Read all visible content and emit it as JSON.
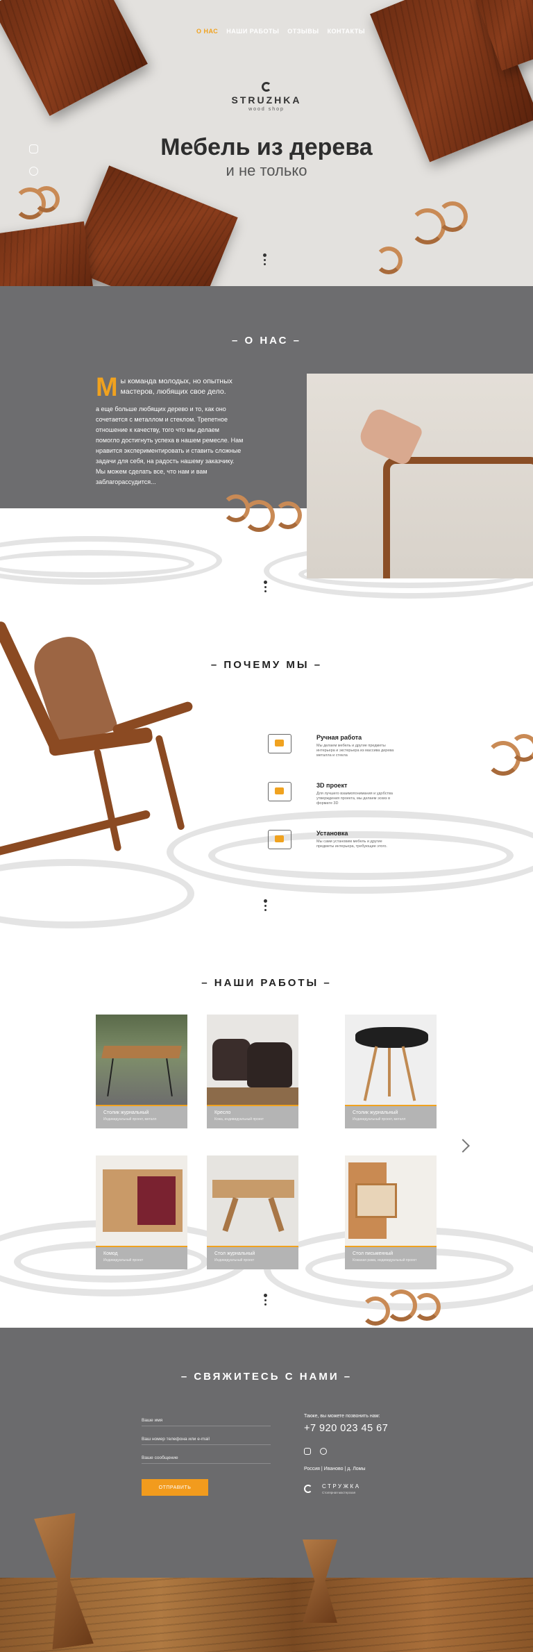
{
  "nav": {
    "items": [
      "О НАС",
      "НАШИ РАБОТЫ",
      "ОТЗЫВЫ",
      "КОНТАКТЫ"
    ]
  },
  "hero": {
    "logo_name": "STRUZHKA",
    "logo_sub": "wood shop",
    "title": "Мебель из дерева",
    "subtitle": "и не только"
  },
  "about": {
    "title": "– О НАС –",
    "dropcap": "М",
    "lead": "ы команда молодых, но опытных мастеров, любящих свое дело.",
    "body": "а еще больше любящих дерево и то, как оно сочетается с металлом и стеклом. Трепетное отношение к качеству, того что мы делаем помогло достигнуть успеха в нашем ремесле. Нам нравится экспериментировать и ставить сложные задачи для себя, на радость нашему заказчику. Мы можем сделать все, что нам и вам заблагорассудится..."
  },
  "why": {
    "title": "– ПОЧЕМУ МЫ –",
    "features": [
      {
        "title": "Ручная работа",
        "desc": "Мы делаем мебель и другие предметы интерьера и экстерьера из массива дерева металла и стекла"
      },
      {
        "title": "3D проект",
        "desc": "Для лучшего взаимопонимания и удобства утверждения проекта, мы делаем эскиз в формате 3D"
      },
      {
        "title": "Установка",
        "desc": "Мы сами установим мебель и другие предметы интерьера, требующие этого."
      }
    ]
  },
  "works": {
    "title": "– НАШИ РАБОТЫ –",
    "cards": [
      {
        "name": "Столик журнальный",
        "desc": "Индивидуальный проект, металл"
      },
      {
        "name": "Кресло",
        "desc": "Кожа, индивидуальный проект"
      },
      {
        "name": "Столик журнальный",
        "desc": "Индивидуальный проект, металл"
      },
      {
        "name": "Комод",
        "desc": "Индивидуальный проект"
      },
      {
        "name": "Стол журнальный",
        "desc": "Индивидуальный проект"
      },
      {
        "name": "Стол письменный",
        "desc": "Кожаная рама, индивидуальный проект"
      }
    ]
  },
  "contact": {
    "title": "– СВЯЖИТЕСЬ С НАМИ –",
    "placeholders": {
      "name": "Ваше имя",
      "phone": "Ваш номер телефона или e-mail",
      "message": "Ваше сообщение"
    },
    "send": "ОТПРАВИТЬ",
    "call_label": "Также, вы можете позвонить нам:",
    "phone": "+7 920 023 45 67",
    "address": "Россия | Иваново | д. Ломы",
    "logo_name": "СТРУЖКА",
    "logo_sub": "Столярная мастерская"
  },
  "colors": {
    "accent": "#f0a21f",
    "gray_section": "#6d6d6f",
    "card_caption": "#b4b4b4"
  },
  "icons": [
    "instagram-icon",
    "flickr-icon",
    "hand-craft-icon",
    "3d-monitor-icon",
    "install-icon",
    "chevron-right-icon"
  ]
}
